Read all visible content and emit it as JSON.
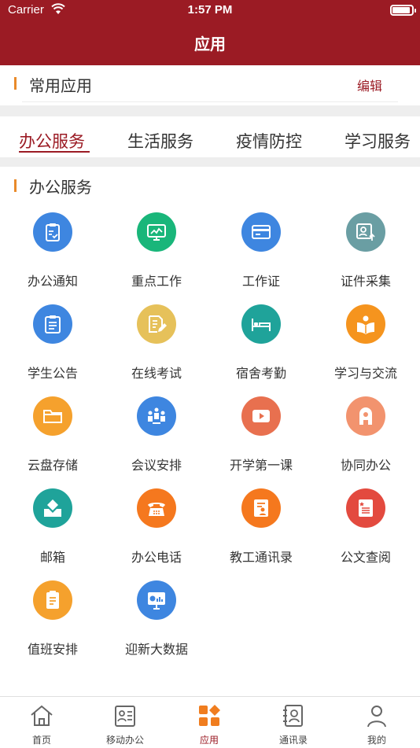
{
  "status_bar": {
    "carrier": "Carrier",
    "time": "1:57 PM"
  },
  "nav": {
    "title": "应用"
  },
  "common_apps": {
    "title": "常用应用",
    "edit_label": "编辑"
  },
  "tabs": [
    {
      "label": "办公服务",
      "active": true
    },
    {
      "label": "生活服务",
      "active": false
    },
    {
      "label": "疫情防控",
      "active": false
    },
    {
      "label": "学习服务",
      "active": false
    }
  ],
  "section": {
    "title": "办公服务"
  },
  "apps": [
    {
      "label": "办公通知",
      "icon": "clipboard-check-icon",
      "color": "#3e86e0"
    },
    {
      "label": "重点工作",
      "icon": "monitor-chart-icon",
      "color": "#19b67a"
    },
    {
      "label": "工作证",
      "icon": "id-card-icon",
      "color": "#3e86e0"
    },
    {
      "label": "证件采集",
      "icon": "photo-upload-icon",
      "color": "#6a9ea3"
    },
    {
      "label": "学生公告",
      "icon": "notice-board-icon",
      "color": "#3e86e0"
    },
    {
      "label": "在线考试",
      "icon": "exam-pencil-icon",
      "color": "#e6c15a"
    },
    {
      "label": "宿舍考勤",
      "icon": "bed-icon",
      "color": "#1fa39a"
    },
    {
      "label": "学习与交流",
      "icon": "book-reader-icon",
      "color": "#f5941e"
    },
    {
      "label": "云盘存储",
      "icon": "folder-icon",
      "color": "#f5a12d"
    },
    {
      "label": "会议安排",
      "icon": "meeting-icon",
      "color": "#3e86e0"
    },
    {
      "label": "开学第一课",
      "icon": "video-play-icon",
      "color": "#e8704f"
    },
    {
      "label": "协同办公",
      "icon": "collaboration-icon",
      "color": "#f2936e"
    },
    {
      "label": "邮箱",
      "icon": "mailbox-icon",
      "color": "#1fa39a"
    },
    {
      "label": "办公电话",
      "icon": "telephone-icon",
      "color": "#f5781e"
    },
    {
      "label": "教工通讯录",
      "icon": "contacts-book-icon",
      "color": "#f5781e"
    },
    {
      "label": "公文查阅",
      "icon": "document-icon",
      "color": "#e34a3f"
    },
    {
      "label": "值班安排",
      "icon": "duty-list-icon",
      "color": "#f5a12d"
    },
    {
      "label": "迎新大数据",
      "icon": "data-screen-icon",
      "color": "#3e86e0"
    }
  ],
  "tabbar": [
    {
      "label": "首页",
      "icon": "home-icon",
      "active": false
    },
    {
      "label": "移动办公",
      "icon": "office-card-icon",
      "active": false
    },
    {
      "label": "应用",
      "icon": "apps-grid-icon",
      "active": true
    },
    {
      "label": "通讯录",
      "icon": "address-book-icon",
      "active": false
    },
    {
      "label": "我的",
      "icon": "profile-icon",
      "active": false
    }
  ],
  "colors": {
    "brand": "#9b1b24",
    "accent": "#e98a2a"
  }
}
